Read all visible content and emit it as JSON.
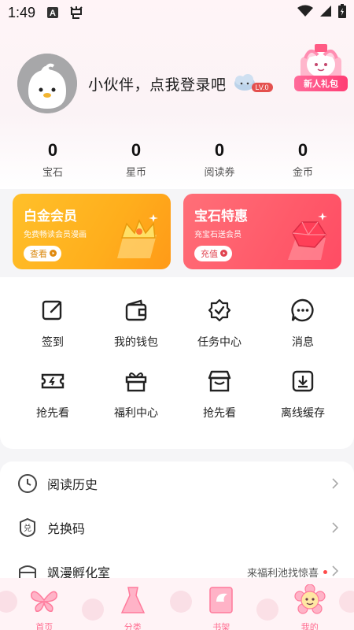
{
  "status_bar": {
    "time": "1:49",
    "icons": [
      "a-icon",
      "bug-icon",
      "wifi-icon",
      "signal-icon",
      "battery-icon"
    ]
  },
  "profile": {
    "login_text": "小伙伴，点我登录吧",
    "level": "LV.0",
    "gift_label": "新人礼包"
  },
  "stats": [
    {
      "value": "0",
      "label": "宝石"
    },
    {
      "value": "0",
      "label": "星币"
    },
    {
      "value": "0",
      "label": "阅读券"
    },
    {
      "value": "0",
      "label": "金币"
    }
  ],
  "cards": {
    "platinum": {
      "title": "白金会员",
      "subtitle": "免费畅读会员漫画",
      "button": "查看"
    },
    "gem": {
      "title": "宝石特惠",
      "subtitle": "充宝石送会员",
      "button": "充值"
    }
  },
  "grid": [
    {
      "label": "签到",
      "icon": "edit-icon"
    },
    {
      "label": "我的钱包",
      "icon": "wallet-icon"
    },
    {
      "label": "任务中心",
      "icon": "task-badge-icon"
    },
    {
      "label": "消息",
      "icon": "message-icon"
    },
    {
      "label": "抢先看",
      "icon": "ticket-icon"
    },
    {
      "label": "福利中心",
      "icon": "gift-box-icon"
    },
    {
      "label": "抢先看",
      "icon": "store-icon"
    },
    {
      "label": "离线缓存",
      "icon": "download-icon"
    }
  ],
  "list": [
    {
      "label": "阅读历史",
      "icon": "clock-icon"
    },
    {
      "label": "兑换码",
      "icon": "redeem-icon"
    },
    {
      "label": "飒漫孵化室",
      "icon": "incubator-icon",
      "note": "来福利池找惊喜"
    }
  ],
  "tabs": [
    {
      "label": "首页",
      "icon": "butterfly-icon"
    },
    {
      "label": "分类",
      "icon": "dress-icon"
    },
    {
      "label": "书架",
      "icon": "book-wing-icon"
    },
    {
      "label": "我的",
      "icon": "flower-face-icon"
    }
  ],
  "colors": {
    "accent_pink": "#ff6b8f",
    "gold_card": "#ffae1c",
    "gem_card": "#ff5a6a",
    "level_badge": "#e4504e"
  }
}
